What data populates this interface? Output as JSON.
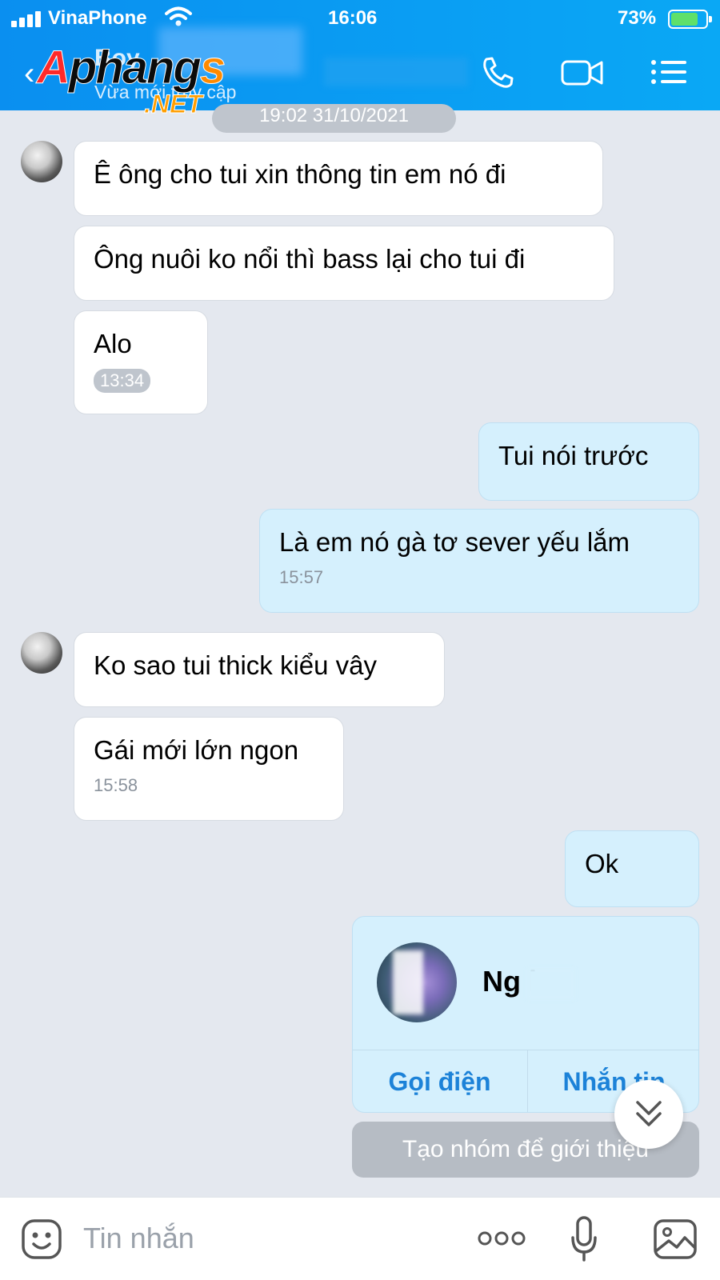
{
  "status_bar": {
    "carrier": "VinaPhone",
    "time": "16:06",
    "battery": "73%"
  },
  "header": {
    "contact_name": "Boy",
    "presence": "Vừa mới truy cập",
    "watermark": "Aphangs .NET"
  },
  "date_separator": "19:02 31/10/2021",
  "messages": [
    {
      "from": "other",
      "text": "Ê ông cho tui xin thông tin em nó đi"
    },
    {
      "from": "other",
      "text": "Ông nuôi ko nổi thì bass lại cho tui đi"
    },
    {
      "from": "other",
      "text": "Alo",
      "time": "13:34"
    },
    {
      "from": "me",
      "text": "Tui nói trước"
    },
    {
      "from": "me",
      "text": "Là em nó gà tơ sever yếu lắm",
      "time": "15:57"
    },
    {
      "from": "other",
      "text": "Ko sao tui thick kiểu vây"
    },
    {
      "from": "other",
      "text": "Gái mới lớn ngon",
      "time": "15:58"
    },
    {
      "from": "me",
      "text": "Ok"
    }
  ],
  "contact_card": {
    "name": "Ng   k",
    "call_label": "Gọi điện",
    "message_label": "Nhắn tin"
  },
  "intro_button": "Tạo nhóm để giới thiệu",
  "input": {
    "placeholder": "Tin nhắn"
  },
  "icons": [
    "back-icon",
    "phone-icon",
    "video-icon",
    "menu-icon",
    "emoji-icon",
    "more-icon",
    "mic-icon",
    "gallery-icon",
    "scroll-down-icon"
  ],
  "colors": {
    "header": "#0a9bf2",
    "outgoing_bubble": "#d5f0fd",
    "incoming_bubble": "#ffffff",
    "accent_text": "#1c82d8"
  }
}
